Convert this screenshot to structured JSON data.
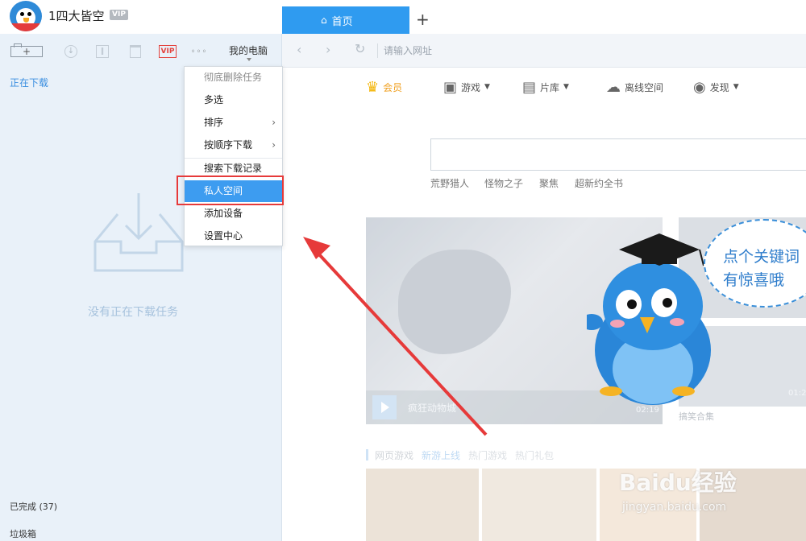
{
  "user": {
    "name": "1四大皆空",
    "vip_badge": "VIP"
  },
  "toolbar": {
    "new_task": "+",
    "vip": "VIP",
    "more": "◦◦◦",
    "my_computer": "我的电脑"
  },
  "left": {
    "downloading": "正在下载",
    "empty_text": "没有正在下载任务",
    "completed": "已完成 (37)",
    "trash": "垃圾箱"
  },
  "tabs": {
    "home": "首页",
    "add": "+"
  },
  "address": {
    "placeholder": "请输入网址"
  },
  "web_nav": [
    {
      "label": "会员",
      "icon": "crown-icon"
    },
    {
      "label": "游戏",
      "icon": "game-icon"
    },
    {
      "label": "片库",
      "icon": "film-icon"
    },
    {
      "label": "离线空间",
      "icon": "cloud-icon"
    },
    {
      "label": "发现",
      "icon": "eye-icon"
    }
  ],
  "hot_searches": [
    "荒野猎人",
    "怪物之子",
    "聚焦",
    "超新约全书"
  ],
  "banner": {
    "title": "疯狂动物城",
    "duration": "02:19"
  },
  "side": {
    "duration": "01:2",
    "caption": "搞笑合集"
  },
  "games": {
    "title": "网页游戏",
    "tabs": [
      "新游上线",
      "热门游戏",
      "热门礼包"
    ]
  },
  "menu": {
    "items": [
      {
        "label": "彻底删除任务",
        "state": "disabled",
        "submenu": false
      },
      {
        "label": "多选",
        "state": "normal",
        "submenu": false
      },
      {
        "label": "排序",
        "state": "normal",
        "submenu": true
      },
      {
        "label": "按顺序下载",
        "state": "normal",
        "submenu": true
      },
      {
        "label": "搜索下载记录",
        "state": "normal",
        "submenu": false
      },
      {
        "label": "私人空间",
        "state": "active",
        "submenu": false
      },
      {
        "label": "添加设备",
        "state": "normal",
        "submenu": false
      },
      {
        "label": "设置中心",
        "state": "normal",
        "submenu": false
      }
    ],
    "submenu_arrow": "›"
  },
  "mascot": {
    "speech": "点个关键词有惊喜哦"
  },
  "watermark": {
    "brand": "Baidu经验",
    "url": "jingyan.baidu.com"
  },
  "colors": {
    "accent": "#2f9bf0",
    "highlight": "#e63a3a",
    "menu_active": "#3d9cf0"
  }
}
